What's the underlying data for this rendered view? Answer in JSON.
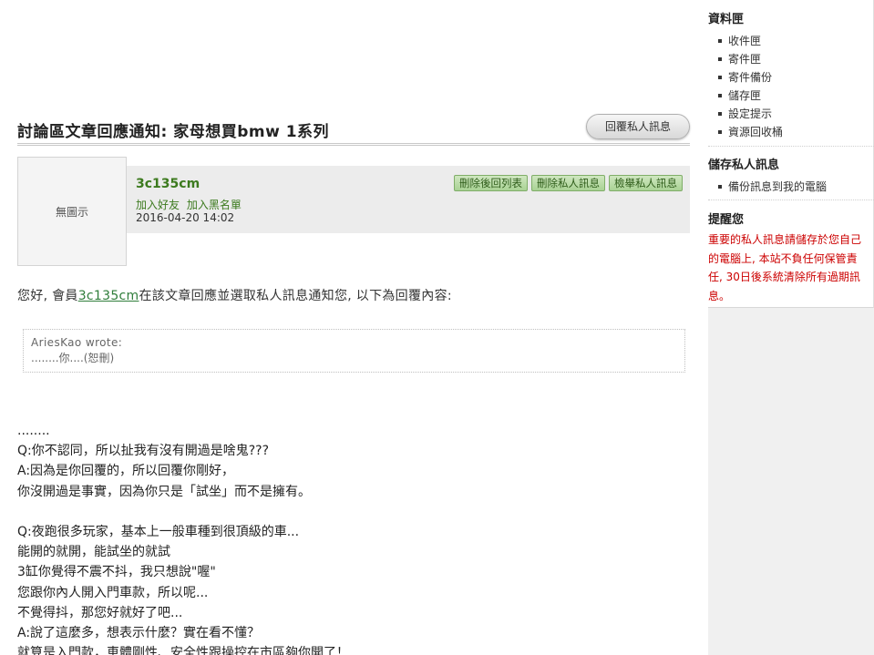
{
  "page": {
    "title": "討論區文章回應通知: 家母想買bmw 1系列",
    "reply_button": "回覆私人訊息"
  },
  "sender": {
    "avatar_text": "無圖示",
    "name": "3c135cm",
    "add_friend": "加入好友",
    "add_block": "加入黑名單",
    "date": "2016-04-20 14:02",
    "actions": {
      "delete_back": "刪除後回列表",
      "delete_pm": "刪除私人訊息",
      "report_pm": "檢舉私人訊息"
    }
  },
  "intro": {
    "before": "您好, 會員",
    "member": "3c135cm",
    "after": "在該文章回應並選取私人訊息通知您, 以下為回覆內容:"
  },
  "quote": {
    "author": "AriesKao wrote:",
    "text": "........你....(恕刪)"
  },
  "body": {
    "lines": [
      "........",
      "Q:你不認同，所以扯我有沒有開過是啥鬼???",
      "A:因為是你回覆的，所以回覆你剛好，",
      "你沒開過是事實，因為你只是「試坐」而不是擁有。",
      "",
      "Q:夜跑很多玩家，基本上一般車種到很頂級的車...",
      "能開的就開，能試坐的就試",
      "3缸你覺得不震不抖，我只想說\"喔\"",
      "您跟你內人開入門車款，所以呢...",
      "不覺得抖，那您好就好了吧...",
      "A:說了這麼多，想表示什麼？實在看不懂？",
      "就算是入門款，車體剛性、安全性跟操控在市區夠你開了！"
    ]
  },
  "sidebar": {
    "folders_title": "資料匣",
    "folders": [
      "收件匣",
      "寄件匣",
      "寄件備份",
      "儲存匣",
      "設定提示",
      "資源回收桶"
    ],
    "save_title": "儲存私人訊息",
    "save_items": [
      "備份訊息到我的電腦"
    ],
    "reminder_title": "提醒您",
    "reminder_lines": [
      "重要的私人訊息請儲存於您自己",
      "的電腦上, 本站不負任何保管責",
      "任, 30日後系統清除所有過期訊",
      "息。"
    ]
  }
}
